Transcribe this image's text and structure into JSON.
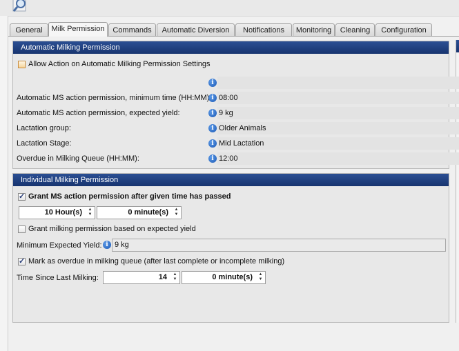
{
  "tabs": [
    "General",
    "Milk Permission",
    "Commands",
    "Automatic Diversion",
    "Notifications",
    "Monitoring",
    "Cleaning",
    "Configuration"
  ],
  "active_tab": "Milk Permission",
  "automatic_group": {
    "title": "Automatic Milking Permission",
    "allow_action_label": "Allow Action on Automatic Milking Permission Settings",
    "rows": [
      {
        "label": "Automatic MS action permission, minimum time (HH:MM):",
        "value": "08:00"
      },
      {
        "label": "Automatic MS action permission, expected yield:",
        "value": "9 kg"
      },
      {
        "label": "Lactation group:",
        "value": "Older Animals"
      },
      {
        "label": "Lactation Stage:",
        "value": "Mid Lactation"
      },
      {
        "label": "Overdue in Milking Queue (HH:MM):",
        "value": "12:00"
      }
    ]
  },
  "individual_group": {
    "title": "Individual Milking Permission",
    "grant_after_time_label": "Grant MS action permission after given time has passed",
    "hours_value": "10 Hour(s)",
    "minutes_value": "0 minute(s)",
    "grant_expected_yield_label": "Grant milking permission based on expected yield",
    "min_expected_yield_label": "Minimum Expected Yield:",
    "min_expected_yield_value": "9 kg",
    "overdue_label": "Mark as overdue in milking queue (after last complete or incomplete milking)",
    "time_since_label": "Time Since Last Milking:",
    "time_since_hours": "14",
    "time_since_minutes": "0 minute(s)"
  },
  "colors": {
    "header_blue": "#1f3f80",
    "info_blue": "#2a6ac8",
    "checkbox_orange": "#e8b25e"
  },
  "icons": {
    "app": "magnifier-icon",
    "info": "info-icon",
    "check": "checkmark-icon",
    "spin": "spin-arrows-icon"
  }
}
